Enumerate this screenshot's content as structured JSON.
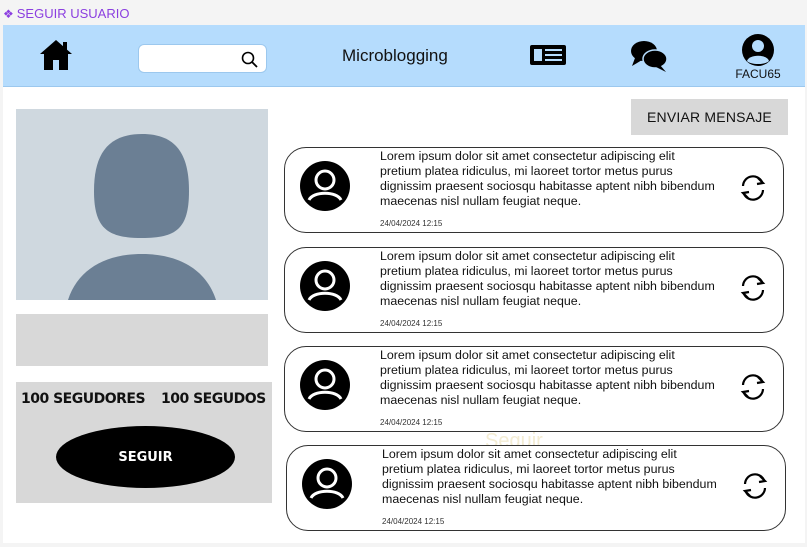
{
  "frame": {
    "label": "SEGUIR USUARIO"
  },
  "topbar": {
    "title": "Microblogging",
    "search": {
      "placeholder": "",
      "value": ""
    },
    "username": "FACU65",
    "background": "#b5dcfd",
    "icons": [
      "home-icon",
      "search-icon",
      "feed-icon",
      "chat-icon",
      "user-avatar-icon"
    ]
  },
  "actions": {
    "send_message": "ENVIAR MENSAJE"
  },
  "profile": {
    "followers": "100 SEGUDORES",
    "following": "100 SEGUDOS",
    "follow_button": "SEGUIR"
  },
  "watermark": "Seguir",
  "posts": [
    {
      "text": "Lorem ipsum dolor sit amet consectetur adipiscing elit pretium platea ridiculus, mi laoreet tortor metus purus dignissim praesent sociosqu habitasse aptent nibh bibendum maecenas nisl nullam feugiat neque.",
      "date": "24/04/2024 12:15"
    },
    {
      "text": "Lorem ipsum dolor sit amet consectetur adipiscing elit pretium platea ridiculus, mi laoreet tortor metus purus dignissim praesent sociosqu habitasse aptent nibh bibendum maecenas nisl nullam feugiat neque.",
      "date": "24/04/2024 12:15"
    },
    {
      "text": "Lorem ipsum dolor sit amet consectetur adipiscing elit pretium platea ridiculus, mi laoreet tortor metus purus dignissim praesent sociosqu habitasse aptent nibh bibendum maecenas nisl nullam feugiat neque.",
      "date": "24/04/2024 12:15"
    },
    {
      "text": "Lorem ipsum dolor sit amet consectetur adipiscing elit pretium platea ridiculus, mi laoreet tortor metus purus dignissim praesent sociosqu habitasse aptent nibh bibendum maecenas nisl nullam feugiat neque.",
      "date": "24/04/2024 12:15"
    }
  ]
}
